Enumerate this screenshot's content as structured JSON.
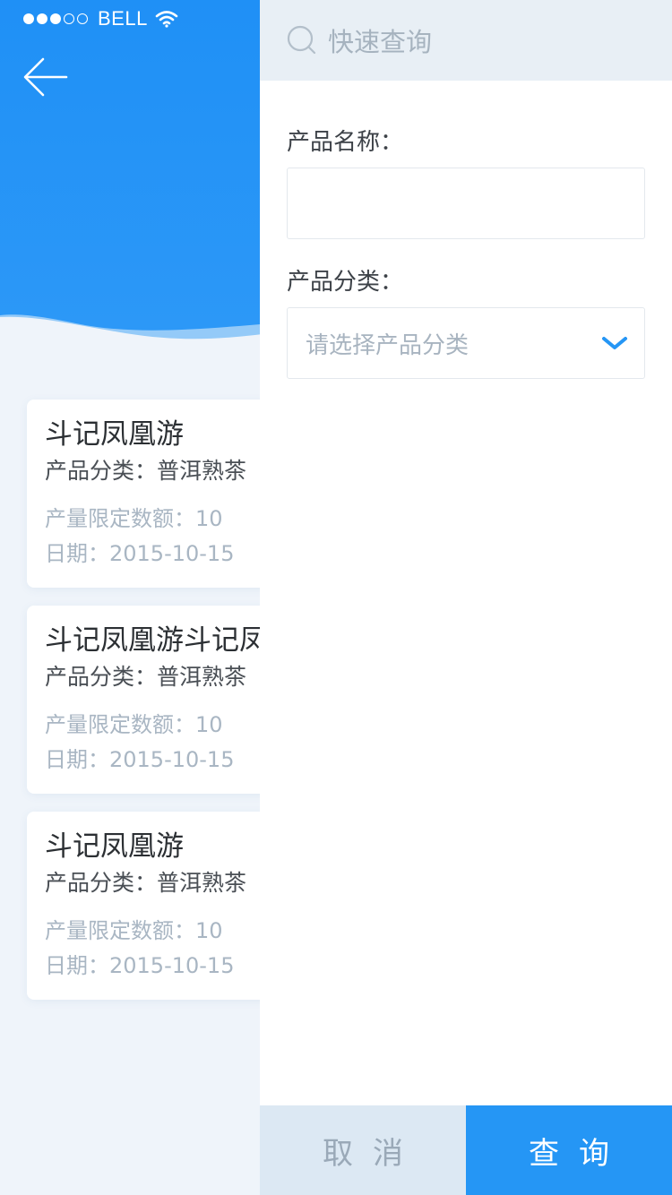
{
  "status_bar": {
    "carrier": "BELL",
    "signal_filled": 3,
    "signal_total": 5
  },
  "colors": {
    "primary_blue": "#2596f5",
    "header_blue": "#1f90f6",
    "light_bg": "#eff4fa",
    "muted_text": "#a9b6c3"
  },
  "cards": [
    {
      "title": "斗记凤凰游",
      "category_label": "产品分类：",
      "category_value": "普洱熟茶",
      "quota": "产量限定数额：10",
      "date": "日期：2015-10-15"
    },
    {
      "title": "斗记凤凰游斗记凤凰游",
      "category_label": "产品分类：",
      "category_value": "普洱熟茶",
      "quota": "产量限定数额：10",
      "date": "日期：2015-10-15"
    },
    {
      "title": "斗记凤凰游",
      "category_label": "产品分类：",
      "category_value": "普洱熟茶",
      "quota": "产量限定数额：10",
      "date": "日期：2015-10-15"
    }
  ],
  "drawer": {
    "title": "快速查询",
    "product_name_label": "产品名称：",
    "product_name_value": "",
    "product_category_label": "产品分类：",
    "product_category_placeholder": "请选择产品分类",
    "cancel_label": "取消",
    "search_label": "查询"
  }
}
